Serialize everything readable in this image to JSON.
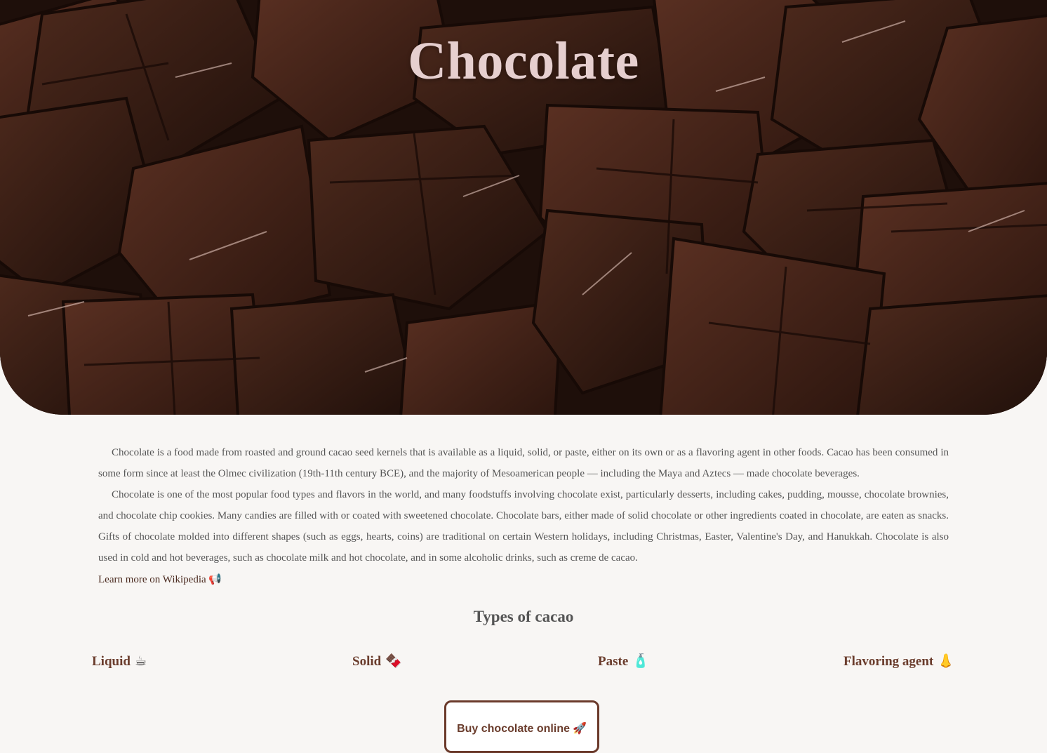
{
  "hero": {
    "title": "Chocolate",
    "image_alt": "Chocolate bars"
  },
  "intro": {
    "paragraphs": [
      "Chocolate is a food made from roasted and ground cacao seed kernels that is available as a liquid, solid, or paste, either on its own or as a flavoring agent in other foods. Cacao has been consumed in some form since at least the Olmec civilization (19th-11th century BCE), and the majority of Mesoamerican people — including the Maya and Aztecs — made chocolate beverages.",
      "Chocolate is one of the most popular food types and flavors in the world, and many foodstuffs involving chocolate exist, particularly desserts, including cakes, pudding, mousse, chocolate brownies, and chocolate chip cookies. Many candies are filled with or coated with sweetened chocolate. Chocolate bars, either made of solid chocolate or other ingredients coated in chocolate, are eaten as snacks. Gifts of chocolate molded into different shapes (such as eggs, hearts, coins) are traditional on certain Western holidays, including Christmas, Easter, Valentine's Day, and Hanukkah. Chocolate is also used in cold and hot beverages, such as chocolate milk and hot chocolate, and in some alcoholic drinks, such as creme de cacao."
    ],
    "wiki_link": "Learn more on Wikipedia",
    "wiki_icon": "📢"
  },
  "types": {
    "title": "Types of cacao",
    "items": [
      {
        "label": "Liquid",
        "icon": "☕",
        "icon_name": "hot-beverage-icon"
      },
      {
        "label": "Solid",
        "icon": "🍫",
        "icon_name": "chocolate-bar-icon"
      },
      {
        "label": "Paste",
        "icon": "🧴",
        "icon_name": "jar-icon"
      },
      {
        "label": "Flavoring agent",
        "icon": "👃",
        "icon_name": "nose-icon"
      }
    ]
  },
  "cta": {
    "label": "Buy chocolate online",
    "icon": "🚀"
  },
  "colors": {
    "background": "#f8f6f4",
    "accent": "#6a3c2c",
    "hero_title": "#e6cfcf"
  }
}
